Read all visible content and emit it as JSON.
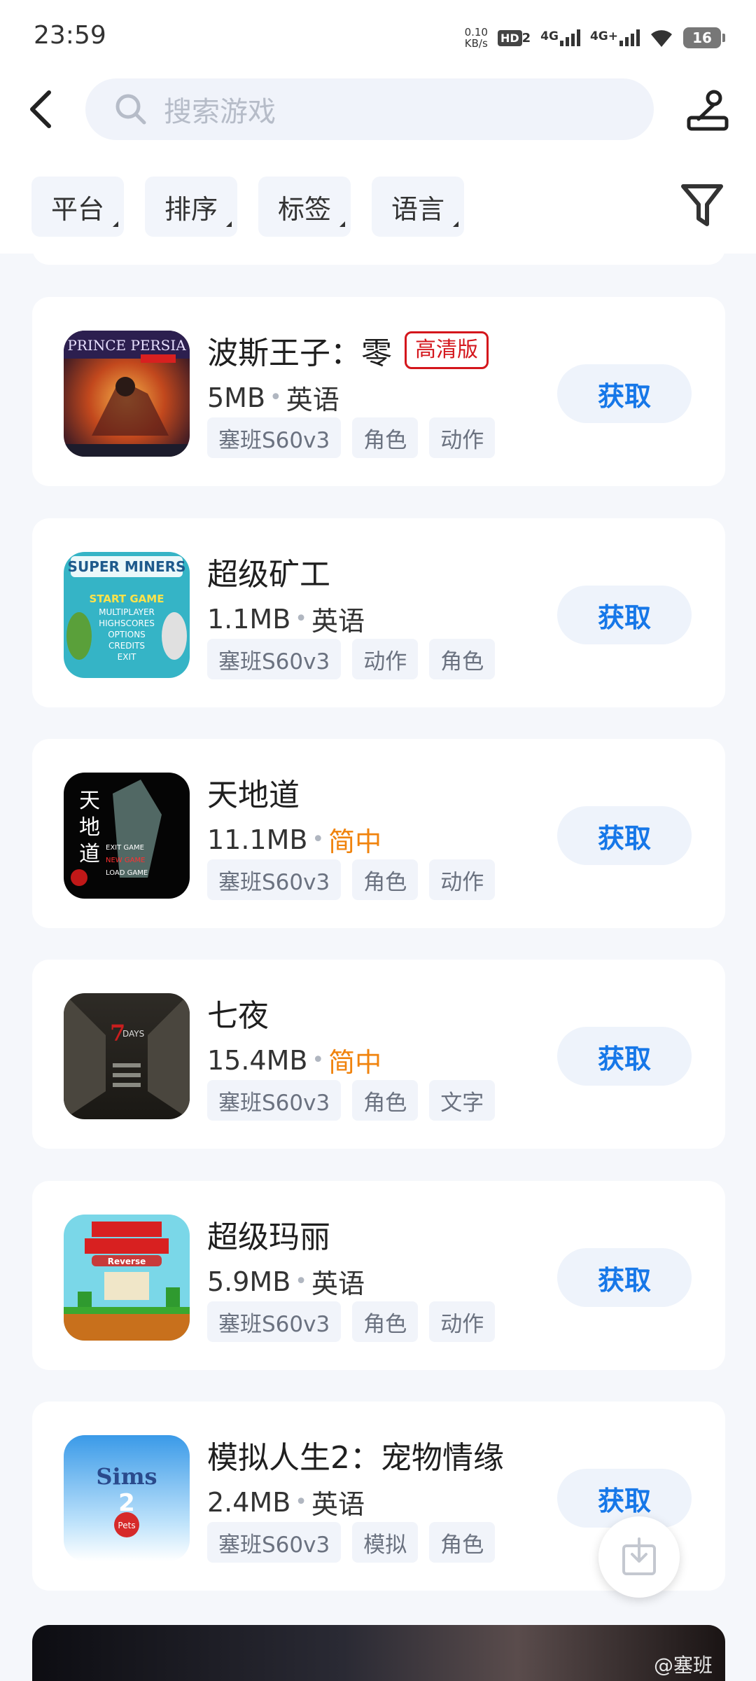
{
  "status_bar": {
    "time": "23:59",
    "net_speed_value": "0.10",
    "net_speed_unit": "KB/s",
    "hd_label": "HD",
    "hd_sub": "2",
    "sim1": "4G",
    "sim2": "4G+",
    "battery": "16"
  },
  "header": {
    "search_placeholder": "搜索游戏"
  },
  "filters": [
    "平台",
    "排序",
    "标签",
    "语言"
  ],
  "games": [
    {
      "name": "波斯王子：零",
      "badge": "高清版",
      "size": "5MB",
      "language": "英语",
      "lang_color": "normal",
      "tags": [
        "塞班S60v3",
        "角色",
        "动作"
      ],
      "button": "获取",
      "icon": "prince-of-persia-icon"
    },
    {
      "name": "超级矿工",
      "badge": "",
      "size": "1.1MB",
      "language": "英语",
      "lang_color": "normal",
      "tags": [
        "塞班S60v3",
        "动作",
        "角色"
      ],
      "button": "获取",
      "icon": "super-miners-icon"
    },
    {
      "name": "天地道",
      "badge": "",
      "size": "11.1MB",
      "language": "简中",
      "lang_color": "orange",
      "tags": [
        "塞班S60v3",
        "角色",
        "动作"
      ],
      "button": "获取",
      "icon": "tiandidao-icon"
    },
    {
      "name": "七夜",
      "badge": "",
      "size": "15.4MB",
      "language": "简中",
      "lang_color": "orange",
      "tags": [
        "塞班S60v3",
        "角色",
        "文字"
      ],
      "button": "获取",
      "icon": "seven-nights-icon"
    },
    {
      "name": "超级玛丽",
      "badge": "",
      "size": "5.9MB",
      "language": "英语",
      "lang_color": "normal",
      "tags": [
        "塞班S60v3",
        "角色",
        "动作"
      ],
      "button": "获取",
      "icon": "super-mario-icon"
    },
    {
      "name": "模拟人生2：宠物情缘",
      "badge": "",
      "size": "2.4MB",
      "language": "英语",
      "lang_color": "normal",
      "tags": [
        "塞班S60v3",
        "模拟",
        "角色"
      ],
      "button": "获取",
      "icon": "sims2-pets-icon"
    }
  ],
  "watermark": "@塞班"
}
